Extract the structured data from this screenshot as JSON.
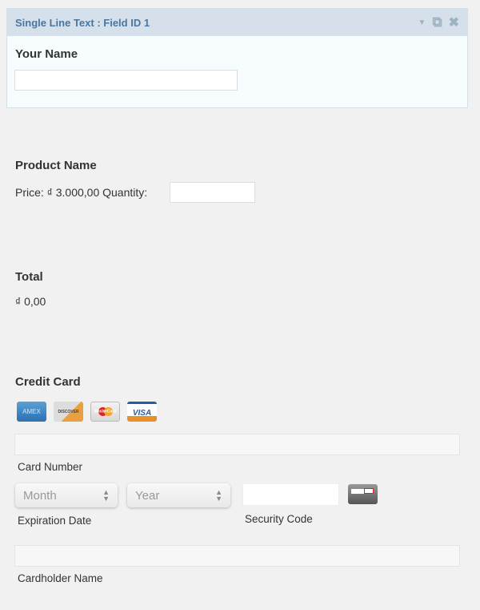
{
  "field_header": {
    "title": "Single Line Text : Field ID 1",
    "icons": [
      "caret-down-icon",
      "duplicate-icon",
      "close-icon"
    ]
  },
  "your_name": {
    "label": "Your Name",
    "value": ""
  },
  "product": {
    "label": "Product Name",
    "price_text": "Price: ₫ 3.000,00 Quantity:",
    "quantity": ""
  },
  "total": {
    "label": "Total",
    "value": "₫ 0,00"
  },
  "credit_card": {
    "label": "Credit Card",
    "cards": [
      "AMEX",
      "DISCOVER",
      "MasterCard",
      "VISA"
    ],
    "card_number_label": "Card Number",
    "month_placeholder": "Month",
    "year_placeholder": "Year",
    "expiration_label": "Expiration Date",
    "security_label": "Security Code",
    "cardholder_label": "Cardholder Name"
  }
}
